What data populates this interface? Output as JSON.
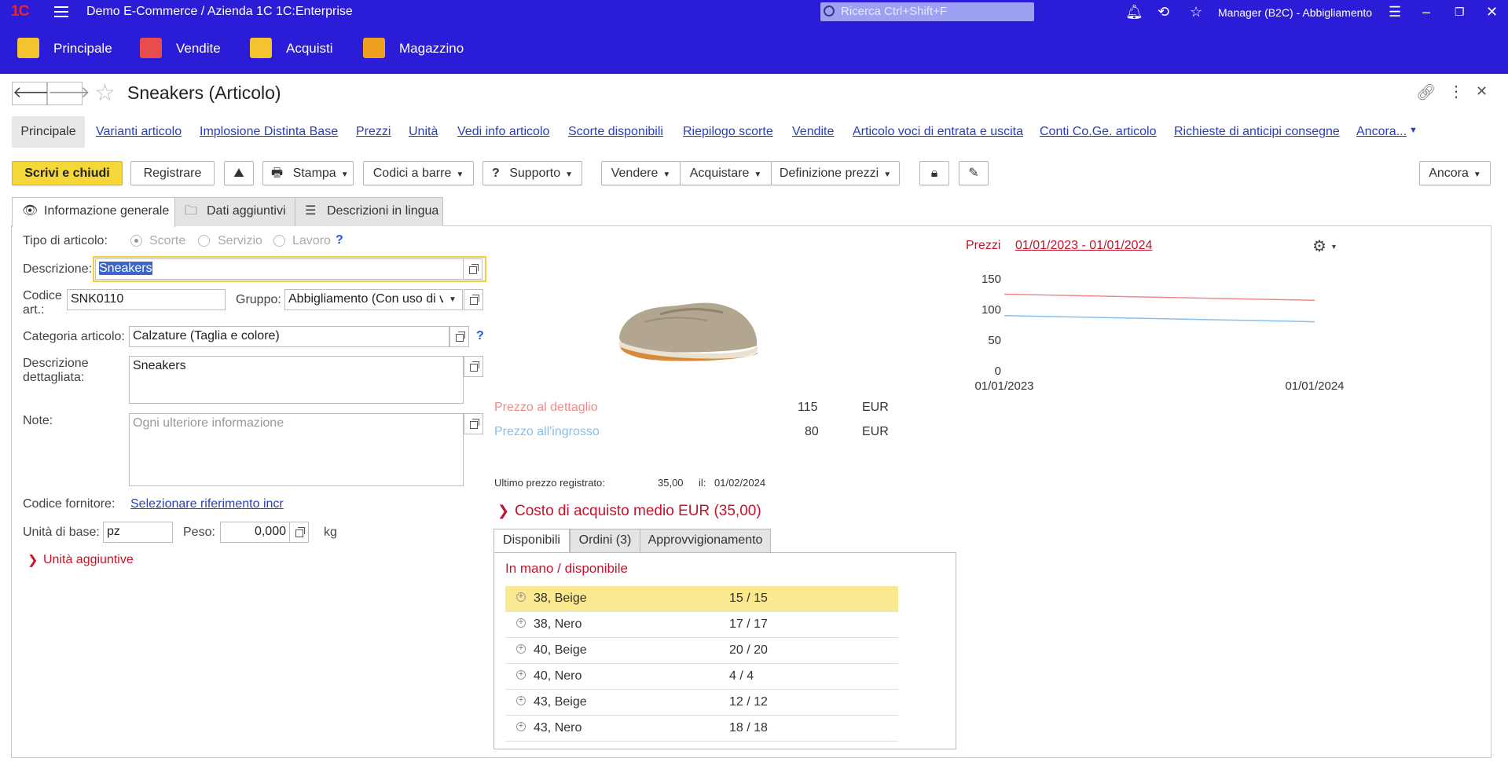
{
  "app": {
    "title": "Demo E-Commerce / Azienda 1C 1C:Enterprise",
    "search_placeholder": "Ricerca Ctrl+Shift+F",
    "user": "Manager (B2C) - Abbigliamento",
    "sections": [
      "Principale",
      "Vendite",
      "Acquisti",
      "Magazzino"
    ]
  },
  "doc": {
    "title": "Sneakers (Articolo)",
    "links": [
      "Principale",
      "Varianti articolo",
      "Implosione Distinta Base",
      "Prezzi",
      "Unità",
      "Vedi info articolo",
      "Scorte disponibili",
      "Riepilogo scorte",
      "Vendite",
      "Articolo voci di entrata e uscita",
      "Conti Co.Ge. articolo",
      "Richieste di anticipi consegne",
      "Ancora..."
    ]
  },
  "toolbar": {
    "save_close": "Scrivi e chiudi",
    "register": "Registrare",
    "print": "Stampa",
    "barcodes": "Codici a barre",
    "support": "Supporto",
    "sell": "Vendere",
    "buy": "Acquistare",
    "price_def": "Definizione prezzi",
    "more": "Ancora"
  },
  "tabs": [
    "Informazione generale",
    "Dati aggiuntivi",
    "Descrizioni in lingua"
  ],
  "form": {
    "type_label": "Tipo di articolo:",
    "type_options": [
      "Scorte",
      "Servizio",
      "Lavoro"
    ],
    "desc_label": "Descrizione:",
    "desc_value": "Sneakers",
    "code_label_1": "Codice",
    "code_label_2": "art.:",
    "code_value": "SNK0110",
    "group_label": "Gruppo:",
    "group_value": "Abbigliamento (Con uso di v",
    "category_label": "Categoria articolo:",
    "category_value": "Calzature (Taglia e colore)",
    "detail_label_1": "Descrizione",
    "detail_label_2": "dettagliata:",
    "detail_value": "Sneakers",
    "notes_label": "Note:",
    "notes_placeholder": "Ogni ulteriore informazione",
    "supplier_label": "Codice fornitore:",
    "supplier_link": "Selezionare riferimento incr",
    "unit_label": "Unità di base:",
    "unit_value": "pz",
    "weight_label": "Peso:",
    "weight_value": "0,000",
    "weight_unit": "kg",
    "extra_units": "Unità aggiuntive"
  },
  "prices": {
    "retail_label": "Prezzo al dettaglio",
    "retail_value": "115",
    "wholesale_label": "Prezzo all'ingrosso",
    "wholesale_value": "80",
    "currency": "EUR",
    "last_label": "Ultimo prezzo registrato:",
    "last_value": "35,00",
    "last_date_label": "il:",
    "last_date": "01/02/2024",
    "avg_cost": "Costo di acquisto medio EUR (35,00)",
    "retail_color": "#f08a8a",
    "wholesale_color": "#84bff0"
  },
  "stock": {
    "tabs": [
      "Disponibili",
      "Ordini (3)",
      "Approvvigionamento"
    ],
    "heading": "In mano / disponibile",
    "rows": [
      {
        "name": "38, Beige",
        "qty": "15 / 15"
      },
      {
        "name": "38, Nero",
        "qty": "17 / 17"
      },
      {
        "name": "40, Beige",
        "qty": "20 / 20"
      },
      {
        "name": "40, Nero",
        "qty": "4 / 4"
      },
      {
        "name": "43, Beige",
        "qty": "12 / 12"
      },
      {
        "name": "43, Nero",
        "qty": "18 / 18"
      }
    ]
  },
  "chart_data": {
    "type": "line",
    "title": "Prezzi",
    "period": "01/01/2023 - 01/01/2024",
    "x": [
      "01/01/2023",
      "01/01/2024"
    ],
    "yticks": [
      0,
      50,
      100,
      150
    ],
    "ylim": [
      0,
      150
    ],
    "series": [
      {
        "name": "Prezzo al dettaglio",
        "values": [
          125,
          115
        ],
        "color": "#f08a8a"
      },
      {
        "name": "Prezzo all'ingrosso",
        "values": [
          90,
          80
        ],
        "color": "#84bff0"
      }
    ]
  }
}
